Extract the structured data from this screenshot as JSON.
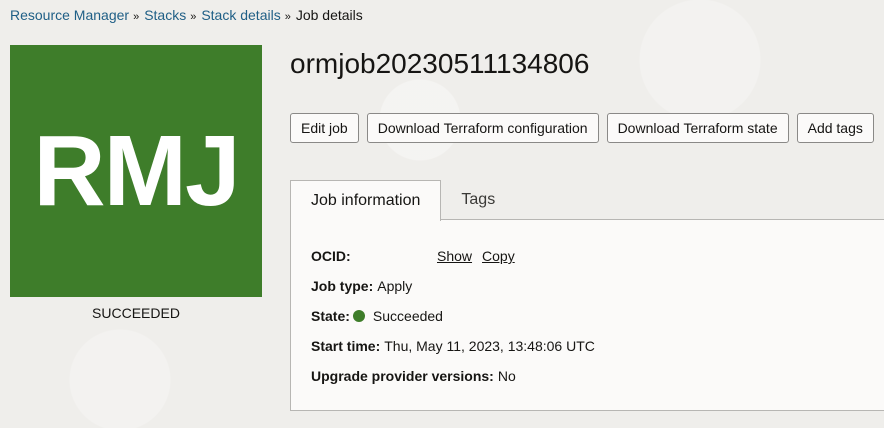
{
  "breadcrumb": {
    "items": [
      "Resource Manager",
      "Stacks",
      "Stack details"
    ],
    "separator": "»",
    "current": "Job details"
  },
  "job_icon": {
    "text": "RMJ",
    "color": "#3e7d2a"
  },
  "status_label": "SUCCEEDED",
  "job_title": "ormjob20230511134806",
  "actions": {
    "edit": "Edit job",
    "download_config": "Download Terraform configuration",
    "download_state": "Download Terraform state",
    "add_tags": "Add tags"
  },
  "tabs": {
    "job_info": "Job information",
    "tags": "Tags"
  },
  "details": {
    "ocid_label": "OCID:",
    "ocid_show": "Show",
    "ocid_copy": "Copy",
    "job_type_label": "Job type:",
    "job_type_value": "Apply",
    "state_label": "State:",
    "state_value": "Succeeded",
    "state_color": "#3e7d2a",
    "start_time_label": "Start time:",
    "start_time_value": "Thu, May 11, 2023, 13:48:06 UTC",
    "upgrade_label": "Upgrade provider versions:",
    "upgrade_value": "No"
  }
}
